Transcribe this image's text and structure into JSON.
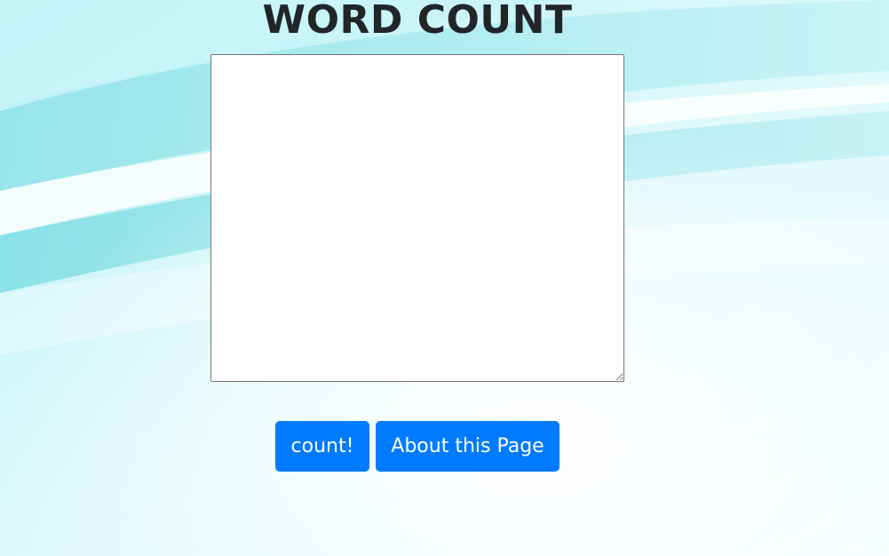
{
  "page": {
    "title": "WORD COUNT"
  },
  "editor": {
    "value": "",
    "placeholder": ""
  },
  "actions": {
    "count_label": "count!",
    "about_label": "About this Page"
  },
  "colors": {
    "button_bg": "#007bff",
    "button_text": "#ffffff",
    "title_text": "#212529",
    "background_tint": "#7fe3e9"
  }
}
